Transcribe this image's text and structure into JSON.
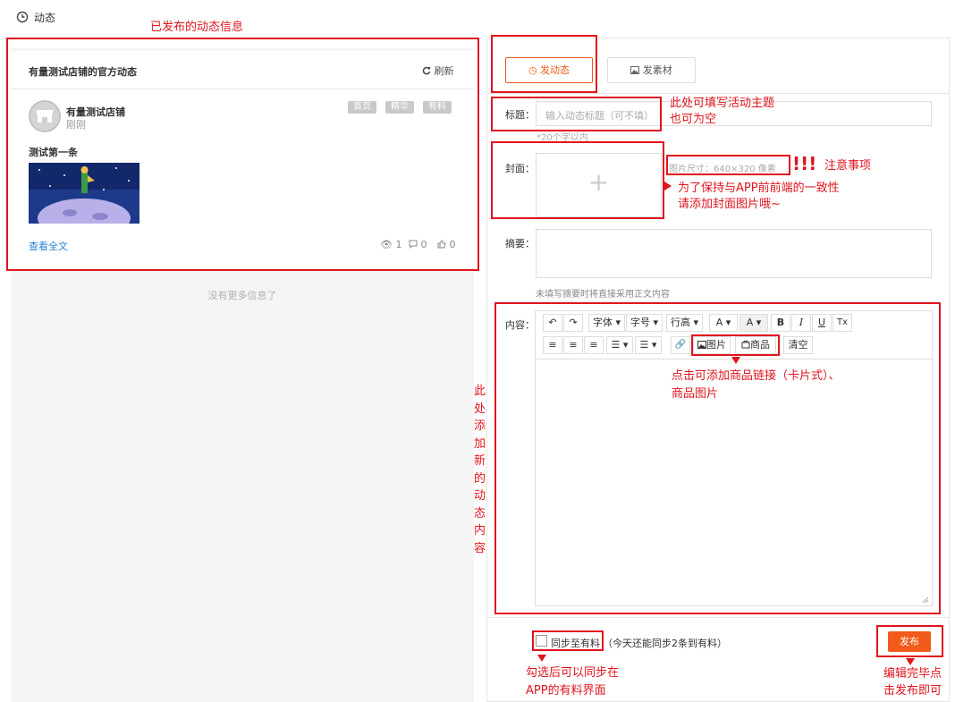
{
  "header": {
    "title": "动态"
  },
  "feed": {
    "card_title": "有量测试店铺的官方动态",
    "refresh_label": "刷新",
    "post": {
      "shop_name": "有量测试店铺",
      "time": "刚刚",
      "tags": [
        "首页",
        "精华",
        "有料"
      ],
      "text": "测试第一条",
      "view_all": "查看全文",
      "views": "1",
      "comments": "0",
      "likes": "0"
    },
    "no_more": "没有更多信息了"
  },
  "form": {
    "tabs": [
      {
        "label": "发动态",
        "active": true
      },
      {
        "label": "发素材",
        "active": false
      }
    ],
    "title_label": "标题：",
    "title_placeholder": "输入动态标题（可不填）",
    "title_hint": "*20个字以内",
    "cover_label": "封面：",
    "cover_size_hint": "图片尺寸：640×320 像素",
    "summary_label": "摘要：",
    "summary_hint": "未填写摘要时将直接采用正文内容",
    "content_label": "内容：",
    "toolbar_row1": [
      "↶",
      "↷",
      "字体 ▾",
      "字号 ▾",
      "行高 ▾",
      "A ▾",
      "A ▾",
      "B",
      "I",
      "U",
      "Tx"
    ],
    "toolbar_row2": [
      "≡",
      "≡",
      "≡",
      "☰ ▾",
      "☰ ▾",
      "🔗",
      "图片",
      "商品",
      "清空"
    ],
    "sync_label": "同步至有料",
    "sync_note": "（今天还能同步2条到有料）",
    "publish_label": "发布"
  },
  "annotations": {
    "published_info": "已发布的动态信息",
    "title_note_1": "此处可填写活动主题",
    "title_note_2": "也可为空",
    "attention_marks": "!!!",
    "attention": "注意事项",
    "cover_note_1": "为了保持与APP前前端的一致性",
    "cover_note_2": "请添加封面图片哦~",
    "toolbar_note_1": "点击可添加商品链接（卡片式）、",
    "toolbar_note_2": "商品图片",
    "content_note": "此处添加新的动态内容",
    "sync_note_1": "勾选后可以同步在",
    "sync_note_2": "APP的有料界面",
    "publish_note_1": "编辑完毕点",
    "publish_note_2": "击发布即可"
  },
  "colors": {
    "accent": "#f05a1a",
    "annotation": "#e0141e",
    "link": "#2a7fd4"
  }
}
